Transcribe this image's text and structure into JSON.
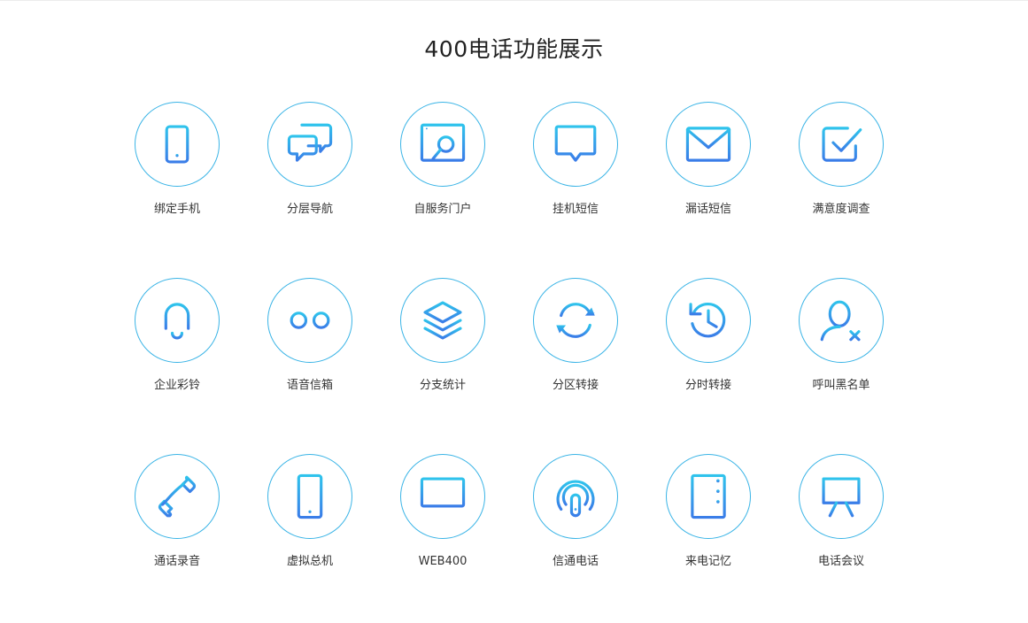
{
  "page": {
    "title": "400电话功能展示",
    "accent_color": "#3ab4e6",
    "icon_gradient": [
      "#2fc3ec",
      "#3a7de8"
    ]
  },
  "features": [
    {
      "label": "绑定手机",
      "icon": "mobile-phone-icon"
    },
    {
      "label": "分层导航",
      "icon": "chat-bubbles-icon"
    },
    {
      "label": "自服务门户",
      "icon": "web-search-icon"
    },
    {
      "label": "挂机短信",
      "icon": "message-icon"
    },
    {
      "label": "漏话短信",
      "icon": "envelope-icon"
    },
    {
      "label": "满意度调查",
      "icon": "checkbox-icon"
    },
    {
      "label": "企业彩铃",
      "icon": "bell-icon"
    },
    {
      "label": "语音信箱",
      "icon": "voicemail-icon"
    },
    {
      "label": "分支统计",
      "icon": "layers-icon"
    },
    {
      "label": "分区转接",
      "icon": "refresh-icon"
    },
    {
      "label": "分时转接",
      "icon": "history-clock-icon"
    },
    {
      "label": "呼叫黑名单",
      "icon": "user-blocked-icon"
    },
    {
      "label": "通话录音",
      "icon": "phone-handset-icon"
    },
    {
      "label": "虚拟总机",
      "icon": "cellphone-icon"
    },
    {
      "label": "WEB400",
      "icon": "monitor-icon"
    },
    {
      "label": "信通电话",
      "icon": "signal-icon"
    },
    {
      "label": "来电记忆",
      "icon": "server-icon"
    },
    {
      "label": "电话会议",
      "icon": "presentation-chart-icon"
    }
  ]
}
